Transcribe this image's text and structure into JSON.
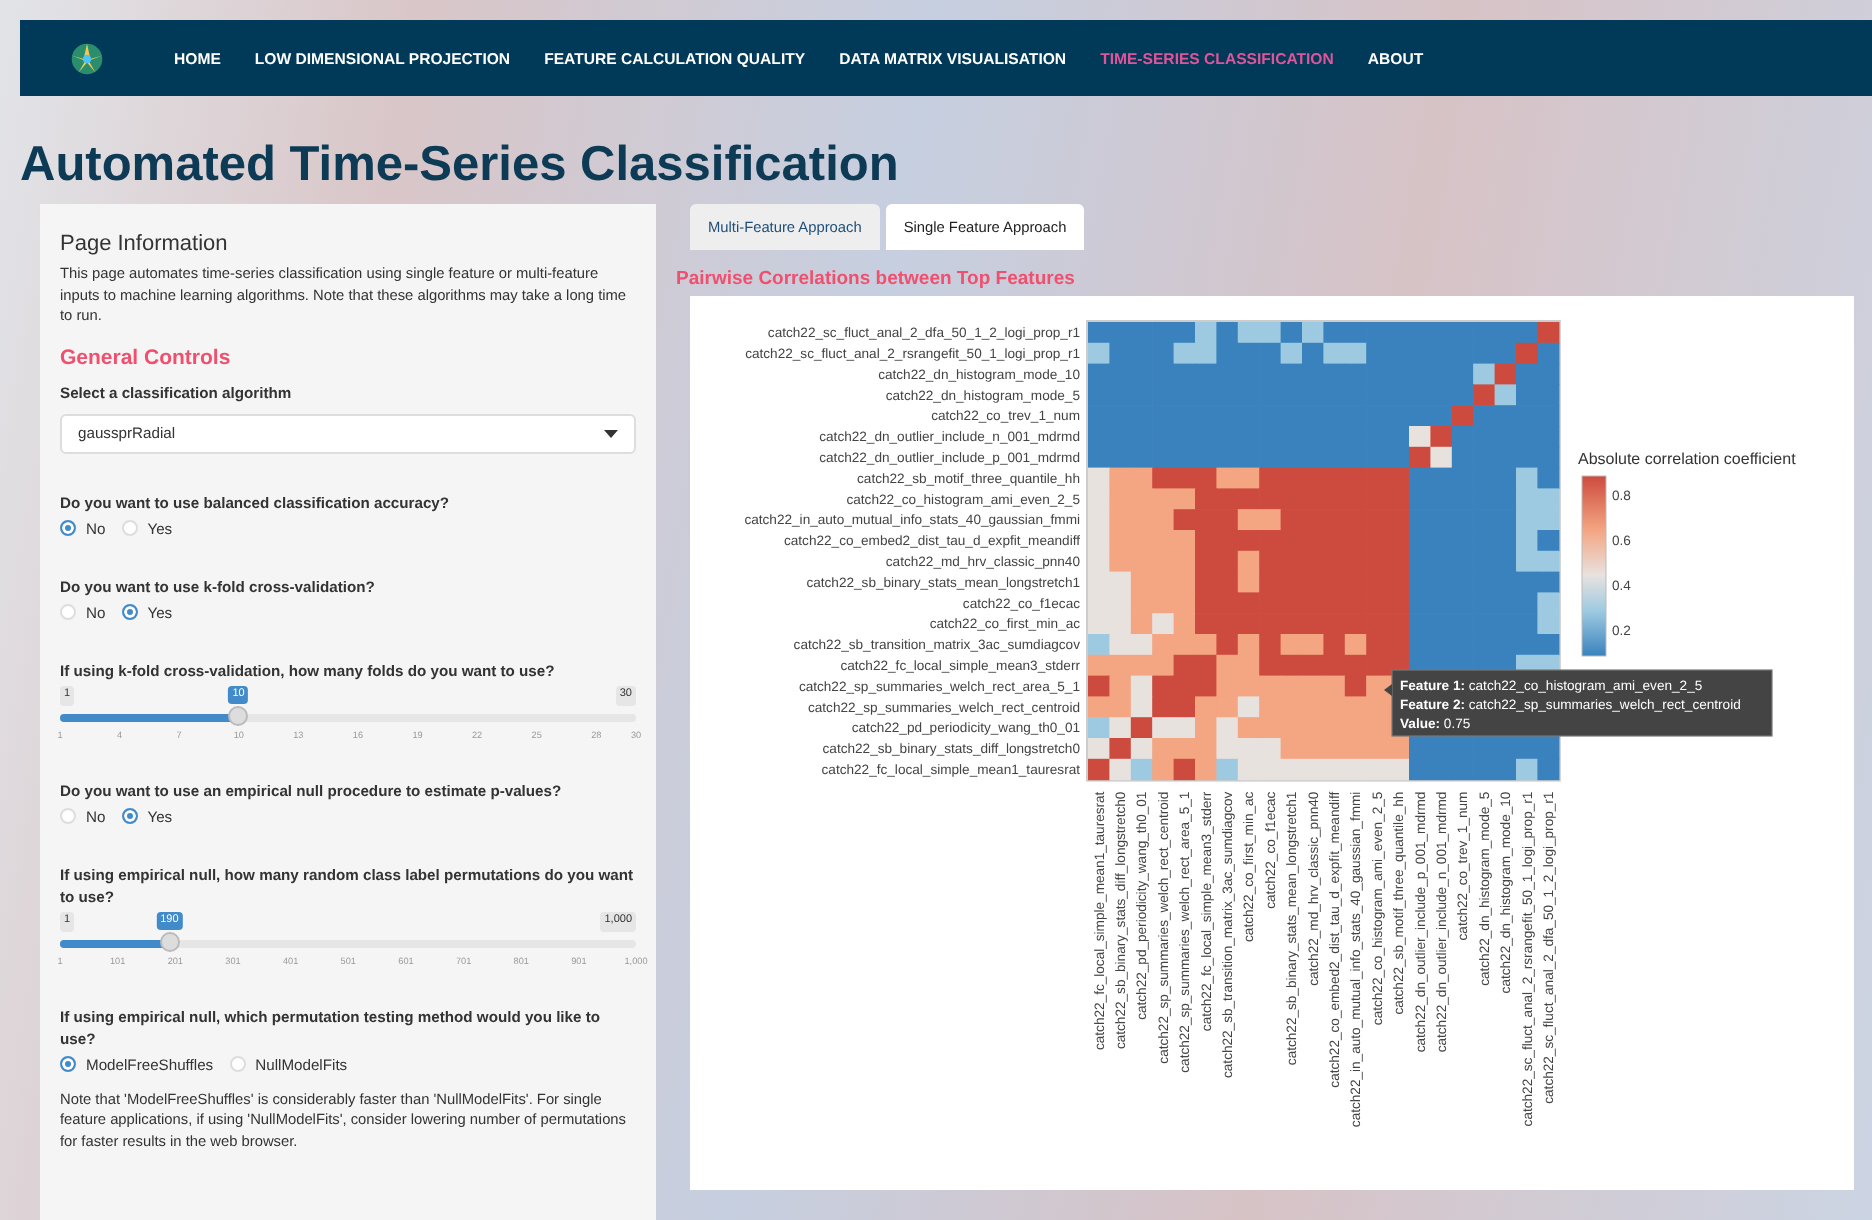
{
  "nav": {
    "items": [
      {
        "label": "HOME",
        "selected": false
      },
      {
        "label": "LOW DIMENSIONAL PROJECTION",
        "selected": false
      },
      {
        "label": "FEATURE CALCULATION QUALITY",
        "selected": false
      },
      {
        "label": "DATA MATRIX VISUALISATION",
        "selected": false
      },
      {
        "label": "TIME-SERIES CLASSIFICATION",
        "selected": true
      },
      {
        "label": "ABOUT",
        "selected": false
      }
    ]
  },
  "page_title": "Automated Time-Series Classification",
  "sidebar": {
    "title": "Page Information",
    "description": "This page automates time-series classification using single feature or multi-feature inputs to machine learning algorithms. Note that these algorithms may take a long time to run.",
    "section_title": "General Controls",
    "controls": [
      {
        "kind": "select",
        "label": "Select a classification algorithm",
        "value": "gaussprRadial"
      },
      {
        "kind": "radio",
        "label": "Do you want to use balanced classification accuracy?",
        "options": [
          {
            "label": "No",
            "selected": true
          },
          {
            "label": "Yes",
            "selected": false
          }
        ]
      },
      {
        "kind": "radio",
        "label": "Do you want to use k-fold cross-validation?",
        "options": [
          {
            "label": "No",
            "selected": false
          },
          {
            "label": "Yes",
            "selected": true
          }
        ]
      },
      {
        "kind": "slider",
        "label": "If using k-fold cross-validation, how many folds do you want to use?",
        "min": "1",
        "max": "30",
        "value": "10",
        "level": 0.31,
        "ticks": [
          "1",
          "4",
          "7",
          "10",
          "13",
          "16",
          "19",
          "22",
          "25",
          "28",
          "30"
        ]
      },
      {
        "kind": "radio",
        "label": "Do you want to use an empirical null procedure to estimate p-values?",
        "options": [
          {
            "label": "No",
            "selected": false
          },
          {
            "label": "Yes",
            "selected": true
          }
        ]
      },
      {
        "kind": "slider",
        "label": "If using empirical null, how many random class label permutations do you want to use?",
        "min": "1",
        "max": "1,000",
        "value": "190",
        "level": 0.19,
        "ticks": [
          "1",
          "101",
          "201",
          "301",
          "401",
          "501",
          "601",
          "701",
          "801",
          "901",
          "1,000"
        ]
      },
      {
        "kind": "radio",
        "label": "If using empirical null, which permutation testing method would you like to use?",
        "options": [
          {
            "label": "ModelFreeShuffles",
            "selected": true
          },
          {
            "label": "NullModelFits",
            "selected": false
          }
        ]
      },
      {
        "kind": "note",
        "text": "Note that 'ModelFreeShuffles' is considerably faster than 'NullModelFits'. For single feature applications, if using 'NullModelFits', consider lowering number of permutations for faster results in the web browser."
      }
    ]
  },
  "tabs": [
    {
      "label": "Multi-Feature Approach",
      "selected": false
    },
    {
      "label": "Single Feature Approach",
      "selected": true
    }
  ],
  "plot": {
    "title": "Pairwise Correlations between Top Features",
    "y_labels": [
      "catch22_sc_fluct_anal_2_dfa_50_1_2_logi_prop_r1",
      "catch22_sc_fluct_anal_2_rsrangefit_50_1_logi_prop_r1",
      "catch22_dn_histogram_mode_10",
      "catch22_dn_histogram_mode_5",
      "catch22_co_trev_1_num",
      "catch22_dn_outlier_include_n_001_mdrmd",
      "catch22_dn_outlier_include_p_001_mdrmd",
      "catch22_sb_motif_three_quantile_hh",
      "catch22_co_histogram_ami_even_2_5",
      "catch22_in_auto_mutual_info_stats_40_gaussian_fmmi",
      "catch22_co_embed2_dist_tau_d_expfit_meandiff",
      "catch22_md_hrv_classic_pnn40",
      "catch22_sb_binary_stats_mean_longstretch1",
      "catch22_co_f1ecac",
      "catch22_co_first_min_ac",
      "catch22_sb_transition_matrix_3ac_sumdiagcov",
      "catch22_fc_local_simple_mean3_stderr",
      "catch22_sp_summaries_welch_rect_area_5_1",
      "catch22_sp_summaries_welch_rect_centroid",
      "catch22_pd_periodicity_wang_th0_01",
      "catch22_sb_binary_stats_diff_longstretch0",
      "catch22_fc_local_simple_mean1_tauresrat"
    ],
    "x_labels": [
      "catch22_fc_local_simple_mean1_tauresrat",
      "catch22_sb_binary_stats_diff_longstretch0",
      "catch22_pd_periodicity_wang_th0_01",
      "catch22_sp_summaries_welch_rect_centroid",
      "catch22_sp_summaries_welch_rect_area_5_1",
      "catch22_fc_local_simple_mean3_stderr",
      "catch22_sb_transition_matrix_3ac_sumdiagcov",
      "catch22_co_first_min_ac",
      "catch22_co_f1ecac",
      "catch22_sb_binary_stats_mean_longstretch1",
      "catch22_md_hrv_classic_pnn40",
      "catch22_co_embed2_dist_tau_d_expfit_meandiff",
      "catch22_in_auto_mutual_info_stats_40_gaussian_fmmi",
      "catch22_co_histogram_ami_even_2_5",
      "catch22_sb_motif_three_quantile_hh",
      "catch22_dn_outlier_include_p_001_mdrmd",
      "catch22_dn_outlier_include_n_001_mdrmd",
      "catch22_co_trev_1_num",
      "catch22_dn_histogram_mode_5",
      "catch22_dn_histogram_mode_10",
      "catch22_sc_fluct_anal_2_rsrangefit_50_1_logi_prop_r1",
      "catch22_sc_fluct_anal_2_dfa_50_1_2_logi_prop_r1"
    ],
    "legend": {
      "title": "Absolute correlation coefficient",
      "ticks": [
        "0.8",
        "0.6",
        "0.4",
        "0.2"
      ]
    },
    "tooltip": {
      "lines": [
        {
          "label": "Feature 1:",
          "value": "catch22_co_histogram_ami_even_2_5"
        },
        {
          "label": "Feature 2:",
          "value": "catch22_sp_summaries_welch_rect_centroid"
        },
        {
          "label": "Value:",
          "value": "0.75"
        }
      ]
    }
  }
}
